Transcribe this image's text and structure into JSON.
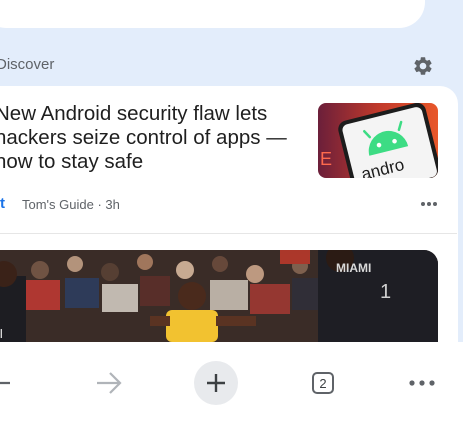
{
  "discover": {
    "label": "Discover",
    "settings_icon": "gear-icon"
  },
  "article": {
    "title": "New Android security flaw lets hackers seize control of apps — how to stay safe",
    "source": "Tom's Guide",
    "source_logo_letter": "t",
    "age": "3h",
    "thumbnail_text": "andro",
    "more_icon": "more-horizontal-icon"
  },
  "hero_image": {
    "jersey_text": "MIAMI"
  },
  "bottom_nav": {
    "back_icon": "back-arrow-icon",
    "forward_icon": "forward-arrow-icon",
    "new_tab_icon": "plus-icon",
    "tab_count": "2",
    "menu_icon": "more-horizontal-icon"
  },
  "colors": {
    "background": "#e3edfb",
    "accent": "#1a73e8",
    "android_green": "#3ddc84"
  }
}
